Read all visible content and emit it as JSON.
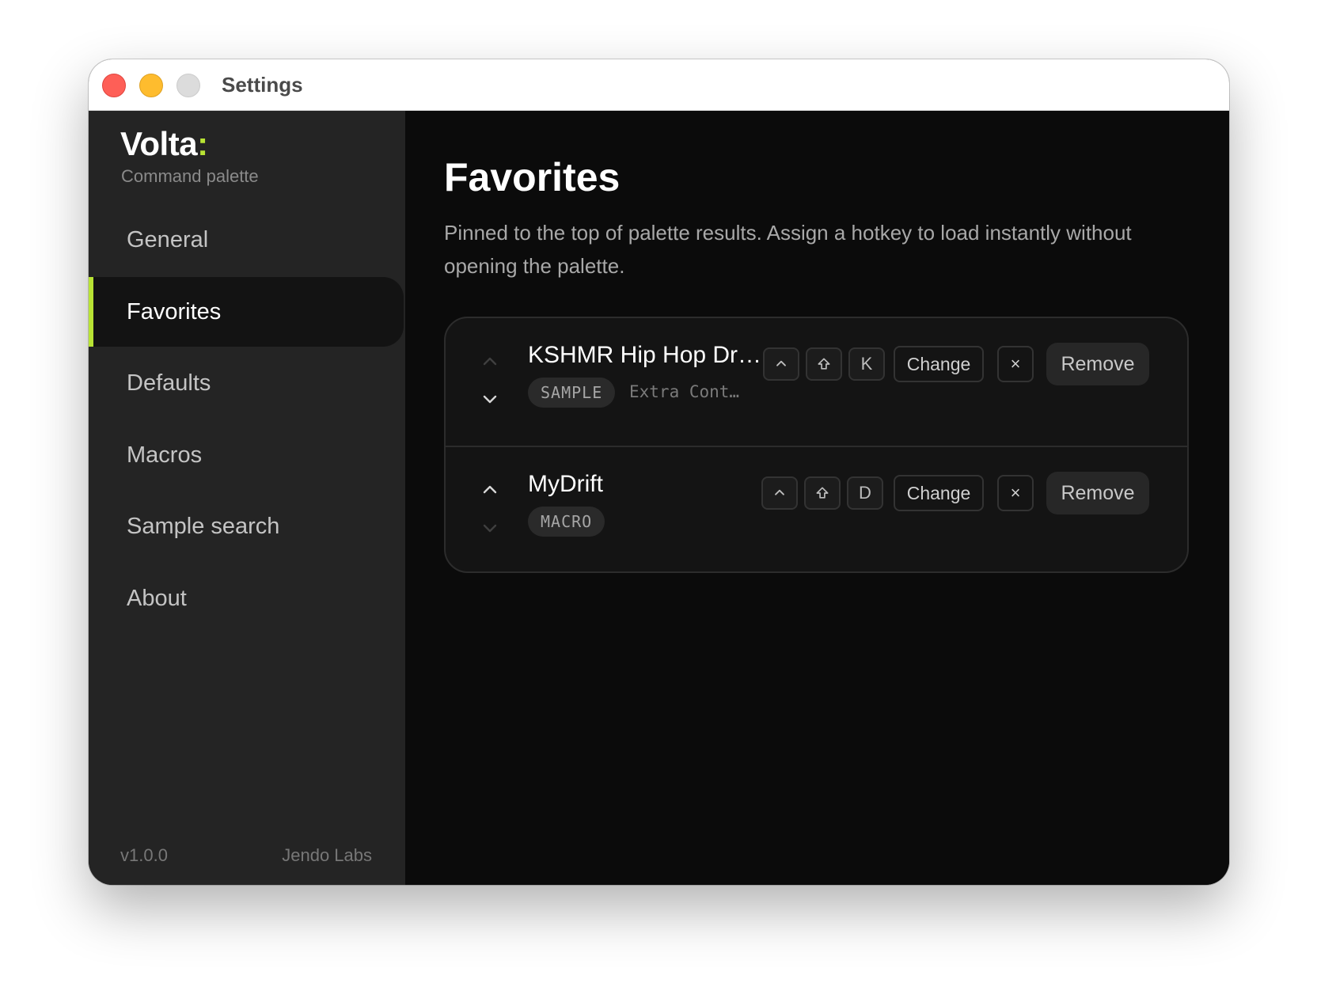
{
  "window": {
    "title": "Settings"
  },
  "sidebar": {
    "brand": "Volta",
    "brand_accent": ":",
    "subtitle": "Command palette",
    "items": [
      {
        "label": "General",
        "active": false
      },
      {
        "label": "Favorites",
        "active": true
      },
      {
        "label": "Defaults",
        "active": false
      },
      {
        "label": "Macros",
        "active": false
      },
      {
        "label": "Sample search",
        "active": false
      },
      {
        "label": "About",
        "active": false
      }
    ],
    "version": "v1.0.0",
    "company": "Jendo Labs"
  },
  "main": {
    "title": "Favorites",
    "description": "Pinned to the top of palette results. Assign a hotkey to load instantly without opening the palette.",
    "favorites": [
      {
        "name": "KSHMR Hip Hop Dr…",
        "type": "SAMPLE",
        "extra": "Extra Cont…",
        "hotkey": [
          "⌃",
          "⇧",
          "K"
        ],
        "change_label": "Change",
        "clear_label": "×",
        "remove_label": "Remove",
        "move_up_enabled": false,
        "move_down_enabled": true
      },
      {
        "name": "MyDrift",
        "type": "MACRO",
        "extra": "",
        "hotkey": [
          "⌃",
          "⇧",
          "D"
        ],
        "change_label": "Change",
        "clear_label": "×",
        "remove_label": "Remove",
        "move_up_enabled": true,
        "move_down_enabled": false
      }
    ]
  },
  "colors": {
    "accent": "#b8e334",
    "sidebar_bg": "#242424",
    "main_bg": "#0b0b0b",
    "card_bg": "#141414"
  },
  "icons": {
    "move_up": "chevron-up-icon",
    "move_down": "chevron-down-icon",
    "control_key": "caret-up-icon",
    "shift_key": "shift-arrow-icon",
    "clear": "close-icon"
  }
}
